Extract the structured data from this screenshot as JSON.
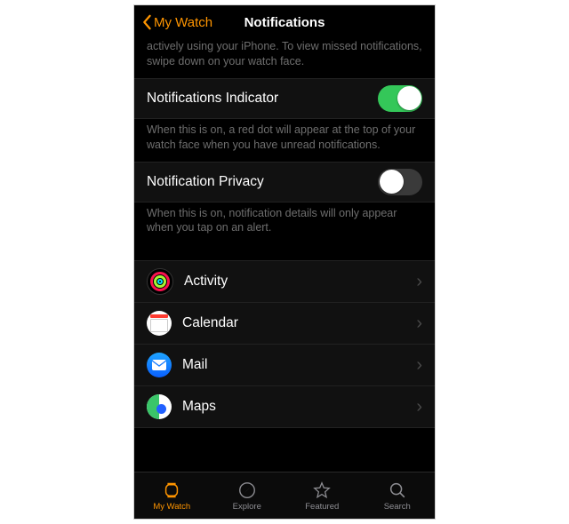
{
  "nav": {
    "back_label": "My Watch",
    "title": "Notifications"
  },
  "topHint": "actively using your iPhone. To view missed notifications, swipe down on your watch face.",
  "settings": [
    {
      "label": "Notifications Indicator",
      "on": true,
      "hint": "When this is on, a red dot will appear at the top of your watch face when you have unread notifications."
    },
    {
      "label": "Notification Privacy",
      "on": false,
      "hint": "When this is on, notification details will only appear when you tap on an alert."
    }
  ],
  "apps": [
    {
      "label": "Activity",
      "icon": "activity"
    },
    {
      "label": "Calendar",
      "icon": "calendar"
    },
    {
      "label": "Mail",
      "icon": "mail"
    },
    {
      "label": "Maps",
      "icon": "maps"
    }
  ],
  "tabs": [
    {
      "label": "My Watch",
      "icon": "watch",
      "active": true
    },
    {
      "label": "Explore",
      "icon": "compass",
      "active": false
    },
    {
      "label": "Featured",
      "icon": "star",
      "active": false
    },
    {
      "label": "Search",
      "icon": "search",
      "active": false
    }
  ],
  "colors": {
    "accent": "#ff9500",
    "toggleOn": "#34c759"
  }
}
